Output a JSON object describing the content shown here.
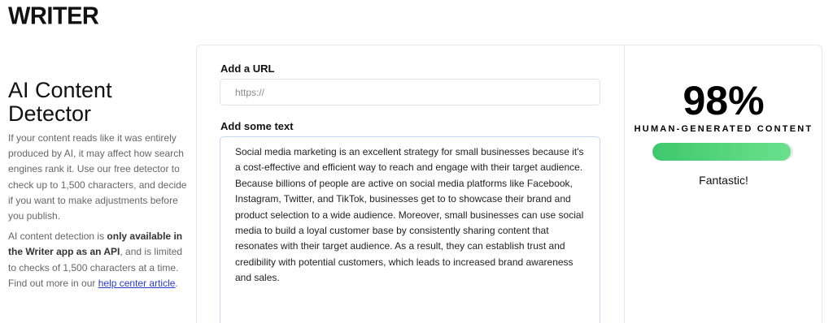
{
  "brand": {
    "logo_text": "WRITER"
  },
  "intro": {
    "title": "AI Content Detector",
    "paragraph1": "If your content reads like it was entirely produced by AI, it may affect how search engines rank it. Use our free detector to check up to 1,500 characters, and decide if you want to make adjustments before you publish.",
    "p2_before": "AI content detection is ",
    "p2_bold": "only available in the Writer app as an API",
    "p2_after": ", and is limited to checks of 1,500 characters at a time. Find out more in our ",
    "p2_link": "help center article",
    "p2_end": "."
  },
  "form": {
    "url_label": "Add a URL",
    "url_placeholder": "https://",
    "text_label": "Add some text",
    "text_value": "Social media marketing is an excellent strategy for small businesses because it's a cost-effective and efficient way to reach and engage with their target audience. Because billions of people are active on social media platforms like Facebook, Instagram, Twitter, and TikTok, businesses get to to showcase their brand and product selection to a wide audience. Moreover, small businesses can use social media to build a loyal customer base by consistently sharing content that resonates with their target audience. As a result, they can establish trust and credibility with potential customers, which leads to increased brand awareness and sales."
  },
  "result": {
    "score_text": "98%",
    "score_value": 0.98,
    "caption": "HUMAN-GENERATED CONTENT",
    "verdict": "Fantastic!",
    "bar_color": "#4cd47a"
  }
}
